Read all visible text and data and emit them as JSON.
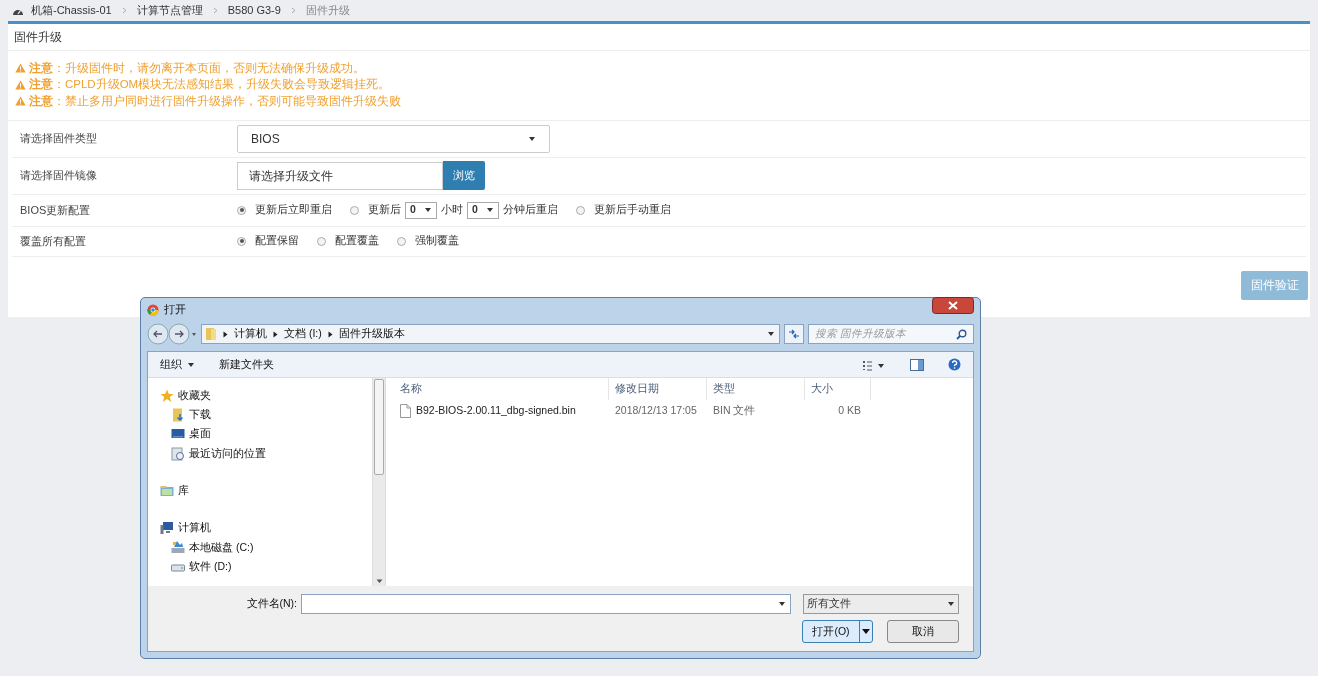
{
  "breadcrumb": [
    {
      "label": "机箱-Chassis-01",
      "current": false
    },
    {
      "label": "计算节点管理",
      "current": false
    },
    {
      "label": "B580 G3-9",
      "current": false
    },
    {
      "label": "固件升级",
      "current": true
    }
  ],
  "panel": {
    "title": "固件升级",
    "warnings": [
      "**注意**：升级固件时，请勿离开本页面，否则无法确保升级成功。",
      "**注意**：CPLD升级OM模块无法感知结果，升级失败会导致逻辑挂死。",
      "**注意**：禁止多用户同时进行固件升级操作，否则可能导致固件升级失败"
    ],
    "rows": [
      {
        "kind": "select",
        "label": "请选择固件类型",
        "value": "BIOS"
      },
      {
        "kind": "file",
        "label": "请选择固件镜像",
        "value": "请选择升级文件",
        "button": "浏览"
      },
      {
        "kind": "radios",
        "label": "BIOS更新配置",
        "options": [
          {
            "selected": true,
            "parts": [
              {
                "kind": "text",
                "text": "更新后立即重启"
              }
            ]
          },
          {
            "selected": false,
            "parts": [
              {
                "kind": "text",
                "text": "更新后"
              },
              {
                "kind": "select",
                "text": "0"
              },
              {
                "kind": "text",
                "text": "小时"
              },
              {
                "kind": "select",
                "text": "0"
              },
              {
                "kind": "text",
                "text": "分钟后重启"
              }
            ]
          },
          {
            "selected": false,
            "parts": [
              {
                "kind": "text",
                "text": "更新后手动重启"
              }
            ]
          }
        ]
      },
      {
        "kind": "radios",
        "label": "覆盖所有配置",
        "options": [
          {
            "selected": true,
            "parts": [
              {
                "kind": "text",
                "text": "配置保留"
              }
            ]
          },
          {
            "selected": false,
            "parts": [
              {
                "kind": "text",
                "text": "配置覆盖"
              }
            ]
          },
          {
            "selected": false,
            "parts": [
              {
                "kind": "text",
                "text": "强制覆盖"
              }
            ]
          }
        ]
      }
    ],
    "verify_button": {
      "label": "固件验证",
      "disabled": true
    }
  },
  "dialog": {
    "title": "打开",
    "path": [
      "计算机",
      "文档 (I:)",
      "固件升级版本"
    ],
    "search": {
      "placeholder": "搜索 固件升级版本"
    },
    "toolbar": [
      {
        "label": "组织",
        "dropdown": true
      },
      {
        "label": "新建文件夹",
        "dropdown": false
      }
    ],
    "nav": [
      {
        "kind": "favorites",
        "label": "收藏夹",
        "children": [
          {
            "kind": "downloads",
            "label": "下载"
          },
          {
            "kind": "desktop",
            "label": "桌面"
          },
          {
            "kind": "recent",
            "label": "最近访问的位置"
          }
        ]
      },
      {
        "kind": "library",
        "label": "库"
      },
      {
        "kind": "computer",
        "label": "计算机",
        "children": [
          {
            "kind": "disk",
            "label": "本地磁盘 (C:)"
          },
          {
            "kind": "drive",
            "label": "软件 (D:)"
          }
        ]
      }
    ],
    "columns": [
      "名称",
      "修改日期",
      "类型",
      "大小"
    ],
    "files": [
      {
        "name": "B92-BIOS-2.00.11_dbg-signed.bin",
        "date": "2018/12/13 17:05",
        "type": "BIN 文件",
        "size": "0 KB",
        "selected": false
      }
    ],
    "filename_label": "文件名(N):",
    "filter": "所有文件",
    "open_button": "打开(O)",
    "cancel_button": "取消"
  }
}
